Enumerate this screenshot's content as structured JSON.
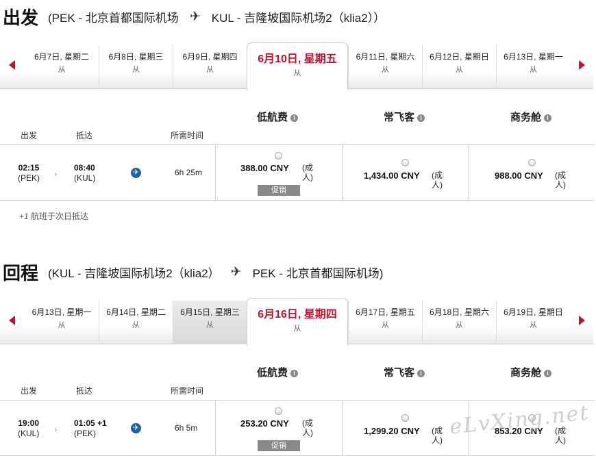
{
  "outbound": {
    "title": "出发",
    "from": "(PEK - 北京首都国际机场",
    "to": "KUL - 吉隆坡国际机场2（klia2））",
    "dates": [
      {
        "date": "6月7日, 星期二",
        "sub": "从"
      },
      {
        "date": "6月8日, 星期三",
        "sub": "从"
      },
      {
        "date": "6月9日, 星期四",
        "sub": "从"
      },
      {
        "date": "6月10日, 星期五",
        "sub": "从"
      },
      {
        "date": "6月11日, 星期六",
        "sub": "从"
      },
      {
        "date": "6月12日, 星期日",
        "sub": "从"
      },
      {
        "date": "6月13日, 星期一",
        "sub": "从"
      }
    ],
    "fare_types": [
      {
        "label": "低航费"
      },
      {
        "label": "常飞客"
      },
      {
        "label": "商务舱"
      }
    ],
    "columns": {
      "depart": "出发",
      "arrive": "抵达",
      "duration": "所需时间"
    },
    "flight": {
      "dep_time": "02:15",
      "dep_airport": "(PEK)",
      "arr_time": "08:40",
      "arr_airport": "(KUL)",
      "duration": "6h 25m",
      "fares": [
        {
          "price": "388.00 CNY",
          "pax": "(成人)",
          "badge": "促销"
        },
        {
          "price": "1,434.00 CNY",
          "pax": "(成人)"
        },
        {
          "price": "988.00 CNY",
          "pax": "(成人)"
        }
      ]
    },
    "note_prefix": "+1",
    "note_text": " 航班于次日抵达"
  },
  "return": {
    "title": "回程",
    "from": "(KUL - 吉隆坡国际机场2（klia2）",
    "to": "PEK - 北京首都国际机场)",
    "dates": [
      {
        "date": "6月13日, 星期一",
        "sub": "从"
      },
      {
        "date": "6月14日, 星期二",
        "sub": "从"
      },
      {
        "date": "6月15日, 星期三",
        "sub": "从"
      },
      {
        "date": "6月16日, 星期四",
        "sub": "从"
      },
      {
        "date": "6月17日, 星期五",
        "sub": "从"
      },
      {
        "date": "6月18日, 星期六",
        "sub": "从"
      },
      {
        "date": "6月19日, 星期日",
        "sub": "从"
      }
    ],
    "fare_types": [
      {
        "label": "低航费"
      },
      {
        "label": "常飞客"
      },
      {
        "label": "商务舱"
      }
    ],
    "columns": {
      "depart": "出发",
      "arrive": "抵达",
      "duration": "所需时间"
    },
    "flight": {
      "dep_time": "19:00",
      "dep_airport": "(KUL)",
      "arr_time": "01:05 +1",
      "arr_airport": "(PEK)",
      "duration": "6h 5m",
      "fares": [
        {
          "price": "253.20 CNY",
          "pax": "(成人)",
          "badge": "促销"
        },
        {
          "price": "1,299.20 CNY",
          "pax": "(成人)"
        },
        {
          "price": "853.20 CNY",
          "pax": "(成人)"
        }
      ]
    }
  },
  "icons": {
    "prev": "chevron-left-icon",
    "next": "chevron-right-icon",
    "info": "info-icon",
    "plane": "airplane-icon",
    "connector": "chevron-right-icon"
  },
  "colors": {
    "accent": "#c8102e",
    "airline_badge": "#1a5fa8",
    "promo_badge": "#888888"
  },
  "watermark": "eLvXing.net"
}
